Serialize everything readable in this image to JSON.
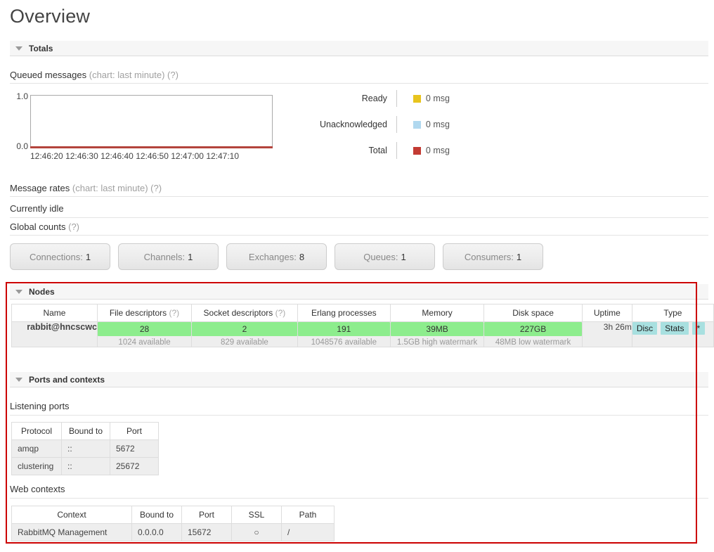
{
  "page": {
    "title": "Overview"
  },
  "sections": {
    "totals": "Totals",
    "nodes": "Nodes",
    "ports_and_contexts": "Ports and contexts"
  },
  "totals": {
    "queued_messages_label": "Queued messages",
    "queued_messages_note": "(chart: last minute)",
    "help": "(?)",
    "message_rates_label": "Message rates",
    "message_rates_note": "(chart: last minute)",
    "currently_idle": "Currently idle",
    "global_counts_label": "Global counts"
  },
  "chart_data": {
    "type": "line",
    "title": "Queued messages (chart: last minute)",
    "xlabel": "",
    "ylabel": "",
    "x": [
      "12:46:20",
      "12:46:30",
      "12:46:40",
      "12:46:50",
      "12:47:00",
      "12:47:10"
    ],
    "ylim": [
      0.0,
      1.0
    ],
    "ytick_labels": [
      "1.0",
      "0.0"
    ],
    "grid": false,
    "legend_position": "right",
    "series": [
      {
        "name": "Ready",
        "color": "#e8c41e",
        "value_label": "0 msg",
        "values": [
          0,
          0,
          0,
          0,
          0,
          0
        ]
      },
      {
        "name": "Unacknowledged",
        "color": "#b0d8ef",
        "value_label": "0 msg",
        "values": [
          0,
          0,
          0,
          0,
          0,
          0
        ]
      },
      {
        "name": "Total",
        "color": "#c33b33",
        "value_label": "0 msg",
        "values": [
          0,
          0,
          0,
          0,
          0,
          0
        ]
      }
    ]
  },
  "global_counts": [
    {
      "label": "Connections:",
      "value": "1"
    },
    {
      "label": "Channels:",
      "value": "1"
    },
    {
      "label": "Exchanges:",
      "value": "8"
    },
    {
      "label": "Queues:",
      "value": "1"
    },
    {
      "label": "Consumers:",
      "value": "1"
    }
  ],
  "nodes": {
    "headers": {
      "name": "Name",
      "file_descriptors": "File descriptors",
      "socket_descriptors": "Socket descriptors",
      "erlang_processes": "Erlang processes",
      "memory": "Memory",
      "disk_space": "Disk space",
      "uptime": "Uptime",
      "type": "Type",
      "help": "(?)"
    },
    "row": {
      "name": "rabbit@hncscwc",
      "file_descriptors": {
        "value": "28",
        "sub": "1024 available"
      },
      "socket_descriptors": {
        "value": "2",
        "sub": "829 available"
      },
      "erlang_processes": {
        "value": "191",
        "sub": "1048576 available"
      },
      "memory": {
        "value": "39MB",
        "sub": "1.5GB high watermark"
      },
      "disk_space": {
        "value": "227GB",
        "sub": "48MB low watermark"
      },
      "uptime": "3h 26m",
      "type_badges": [
        "Disc",
        "Stats",
        "*"
      ]
    }
  },
  "ports": {
    "listening_label": "Listening ports",
    "headers": [
      "Protocol",
      "Bound to",
      "Port"
    ],
    "rows": [
      [
        "amqp",
        "::",
        "5672"
      ],
      [
        "clustering",
        "::",
        "25672"
      ]
    ]
  },
  "contexts": {
    "label": "Web contexts",
    "headers": [
      "Context",
      "Bound to",
      "Port",
      "SSL",
      "Path"
    ],
    "rows": [
      [
        "RabbitMQ Management",
        "0.0.0.0",
        "15672",
        "○",
        "/"
      ]
    ]
  },
  "colors": {
    "annotation": "#cc0000",
    "meter_green": "#8ded8d",
    "badge_blue": "#a8e0e0"
  }
}
